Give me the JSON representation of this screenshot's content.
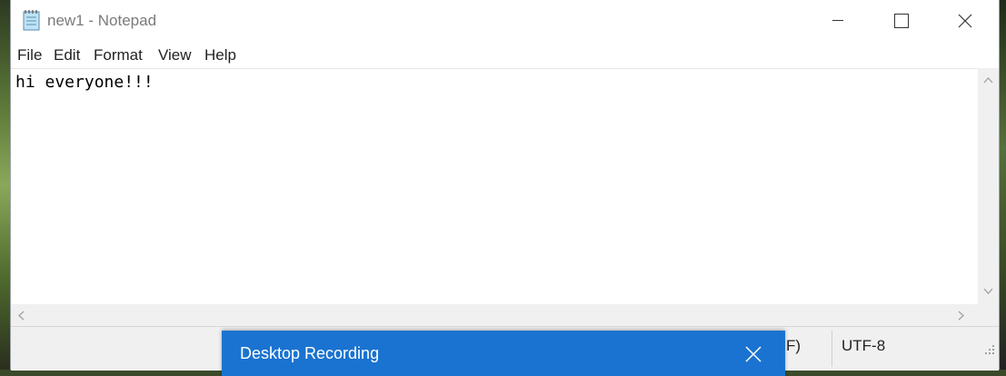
{
  "window": {
    "title": "new1 - Notepad",
    "icon": "notepad-icon"
  },
  "menu": [
    {
      "label": "File"
    },
    {
      "label": "Edit"
    },
    {
      "label": "Format"
    },
    {
      "label": "View"
    },
    {
      "label": "Help"
    }
  ],
  "editor": {
    "content": "hi everyone!!!"
  },
  "statusbar": {
    "partial_text": "F)",
    "encoding": "UTF-8"
  },
  "toast": {
    "title": "Desktop Recording",
    "accent": "#1a73d0"
  }
}
